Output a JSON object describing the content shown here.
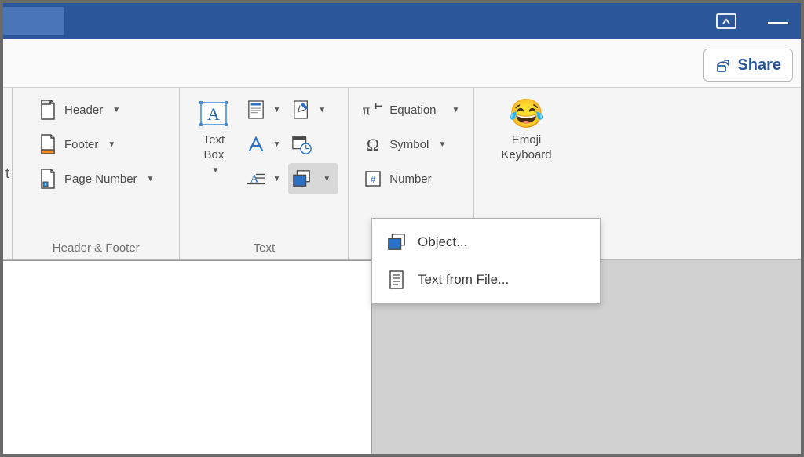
{
  "share_label": "Share",
  "groups": {
    "header_footer": {
      "label": "Header & Footer",
      "header": "Header",
      "footer": "Footer",
      "page_number": "Page Number"
    },
    "text": {
      "label": "Text",
      "text_box": "Text\nBox"
    },
    "symbols": {
      "equation": "Equation",
      "symbol": "Symbol",
      "number": "Number"
    },
    "emoji": {
      "label": "Emoji",
      "keyboard": "Emoji\nKeyboard"
    }
  },
  "dropdown": {
    "object": "Object...",
    "text_from_file": "Text from File..."
  }
}
